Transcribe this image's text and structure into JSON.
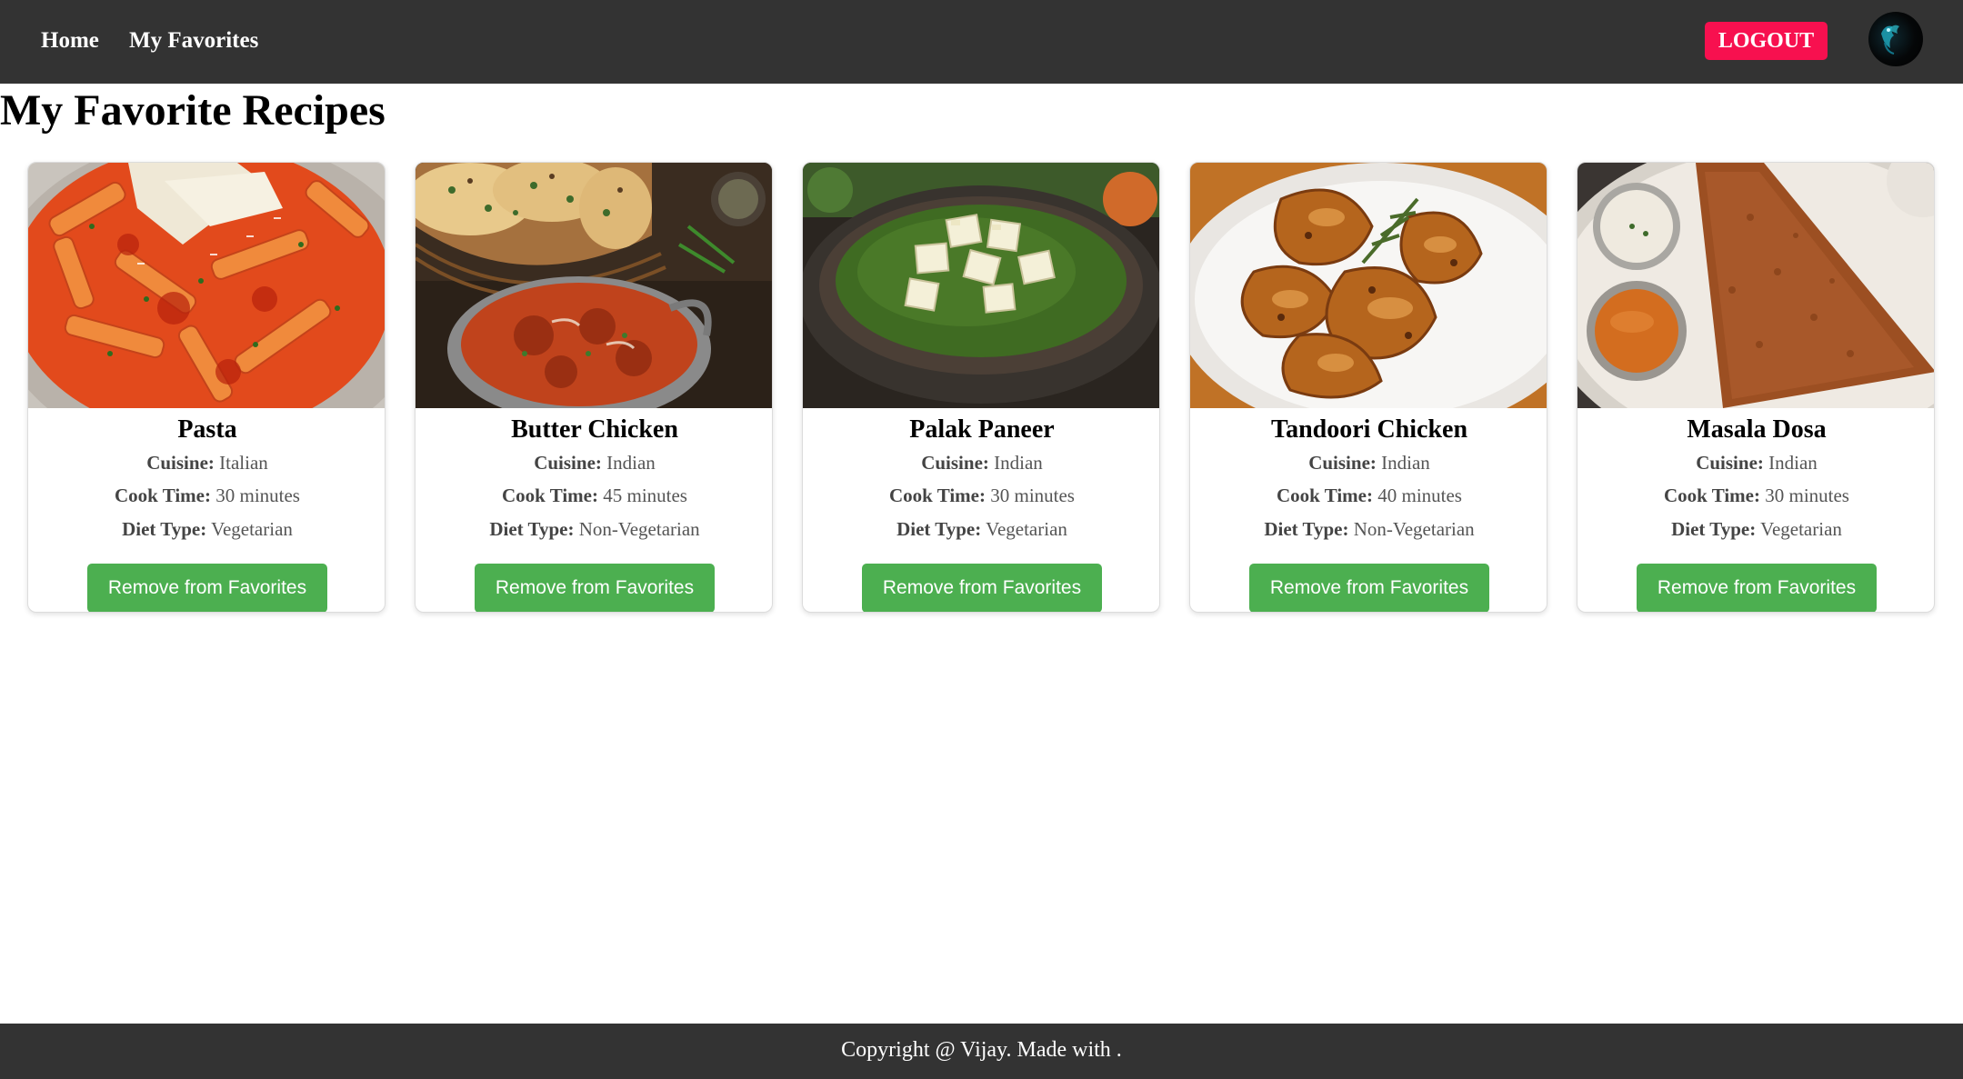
{
  "nav": {
    "home_label": "Home",
    "favorites_label": "My Favorites",
    "logout_label": "LOGOUT",
    "bg_color": "#333333",
    "logout_color": "#f7104f"
  },
  "page": {
    "title": "My Favorite Recipes"
  },
  "labels": {
    "cuisine": "Cuisine:",
    "cook_time": "Cook Time:",
    "diet_type": "Diet Type:",
    "remove_button": "Remove from Favorites"
  },
  "recipes": [
    {
      "name": "Pasta",
      "cuisine": "Italian",
      "cook_time": "30 minutes",
      "diet_type": "Vegetarian"
    },
    {
      "name": "Butter Chicken",
      "cuisine": "Indian",
      "cook_time": "45 minutes",
      "diet_type": "Non-Vegetarian"
    },
    {
      "name": "Palak Paneer",
      "cuisine": "Indian",
      "cook_time": "30 minutes",
      "diet_type": "Vegetarian"
    },
    {
      "name": "Tandoori Chicken",
      "cuisine": "Indian",
      "cook_time": "40 minutes",
      "diet_type": "Non-Vegetarian"
    },
    {
      "name": "Masala Dosa",
      "cuisine": "Indian",
      "cook_time": "30 minutes",
      "diet_type": "Vegetarian"
    }
  ],
  "footer": {
    "text": "Copyright @ Vijay. Made with ."
  },
  "colors": {
    "button_green": "#4caf50",
    "footer_bg": "#333333"
  }
}
